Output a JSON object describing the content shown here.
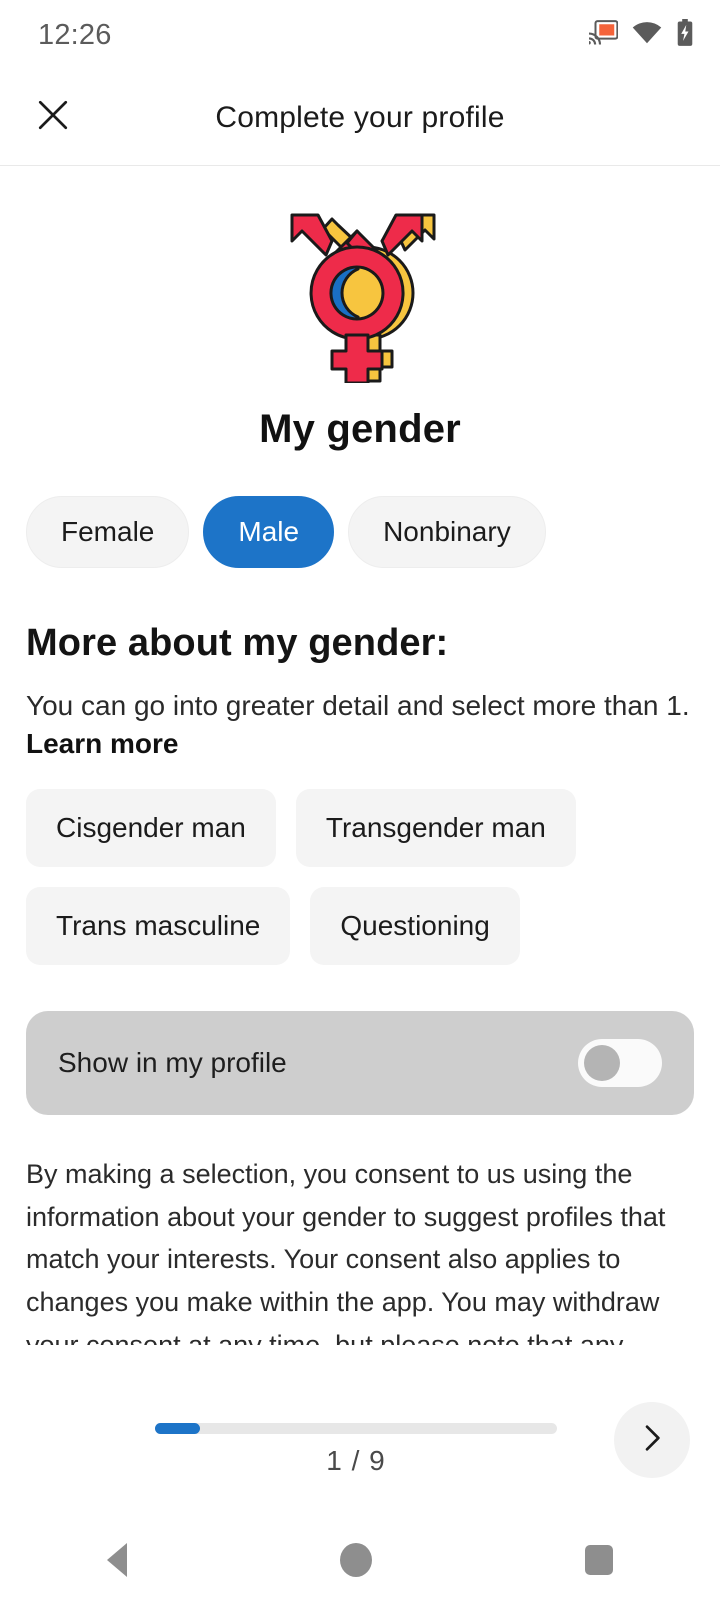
{
  "status_bar": {
    "time": "12:26",
    "icons": [
      "cast-icon",
      "wifi-icon",
      "battery-charging-icon"
    ]
  },
  "header": {
    "close_icon": "close-icon",
    "title": "Complete your profile"
  },
  "hero": {
    "icon": "transgender-symbol-icon",
    "colors": {
      "red": "#ee2b4a",
      "yellow": "#f7c53f",
      "blue": "#1a6fc4",
      "outline": "#1a1a1a"
    }
  },
  "main": {
    "section_title": "My gender",
    "gender_options": [
      {
        "label": "Female",
        "selected": false
      },
      {
        "label": "Male",
        "selected": true
      },
      {
        "label": "Nonbinary",
        "selected": false
      }
    ],
    "more_heading": "More about my gender:",
    "more_description": "You can go into greater detail and select more than 1. ",
    "learn_more_label": "Learn more",
    "detail_chips": [
      "Cisgender man",
      "Transgender man",
      "Trans masculine",
      "Questioning"
    ],
    "show_in_profile": {
      "label": "Show in my profile",
      "toggle_state": "off"
    },
    "consent_text": "By making a selection, you consent to us using the information about your gender to suggest profiles that match your interests. Your consent also applies to changes you make within the app. You may withdraw your consent at any time, but please note that any processing until you withdraw your consent will remain lawful."
  },
  "footer": {
    "progress_percent": 11.1,
    "progress_label": "1 / 9",
    "next_icon": "chevron-right-icon"
  },
  "nav_bar": {
    "back_icon": "back-triangle-icon",
    "home_icon": "home-circle-icon",
    "recents_icon": "recents-square-icon"
  },
  "colors": {
    "accent_blue": "#1d74c8",
    "chip_gray": "#f4f4f4",
    "show_row_gray": "#cecece"
  }
}
